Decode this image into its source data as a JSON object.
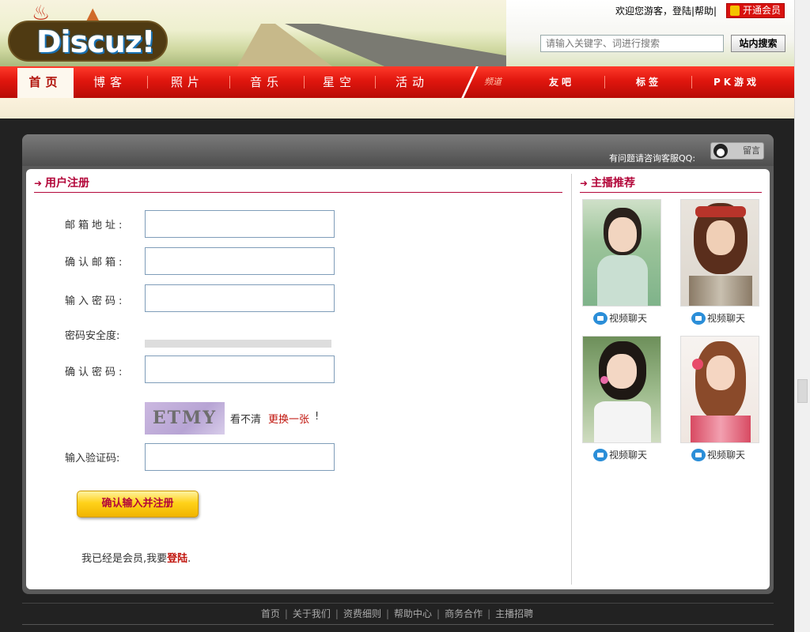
{
  "header": {
    "logo_text": "Discuz!",
    "top_links": "欢迎您游客，登陆|帮助|",
    "vip_button": "开通会员",
    "search_placeholder": "请输入关键字、词进行搜索",
    "search_button": "站内搜索"
  },
  "nav": {
    "home": "首页",
    "items": [
      "博客",
      "照片",
      "音乐",
      "星空",
      "活动"
    ],
    "channel_label": "频道",
    "items2": [
      "友吧",
      "标签",
      "PK游戏"
    ]
  },
  "service": {
    "qq_text": "有问题请咨询客服QQ:",
    "qq_badge": "留言"
  },
  "register": {
    "title": "用户注册",
    "email_label": "邮箱地址:",
    "confirm_email_label": "确认邮箱:",
    "password_label": "输入密码:",
    "strength_label": "密码安全度:",
    "confirm_password_label": "确认密码:",
    "captcha_text": "ETMY",
    "captcha_hint": "看不清",
    "captcha_refresh": "更换一张",
    "captcha_bang": "!",
    "captcha_label": "输入验证码:",
    "submit_button": "确认输入并注册",
    "login_prefix": "我已经是会员,我要",
    "login_link": "登陆",
    "login_suffix": "."
  },
  "anchors": {
    "title": "主播推荐",
    "cards": [
      {
        "chat_label": "视频聊天"
      },
      {
        "chat_label": "视频聊天"
      },
      {
        "chat_label": "视频聊天"
      },
      {
        "chat_label": "视频聊天"
      }
    ]
  },
  "footer": {
    "links": [
      "首页",
      "关于我们",
      "资费细则",
      "帮助中心",
      "商务合作",
      "主播招聘"
    ]
  },
  "colors": {
    "nav_red": "#e0160e",
    "accent": "#b3073a",
    "link_red": "#c0140c",
    "button_yellow": "#ffd21a"
  }
}
